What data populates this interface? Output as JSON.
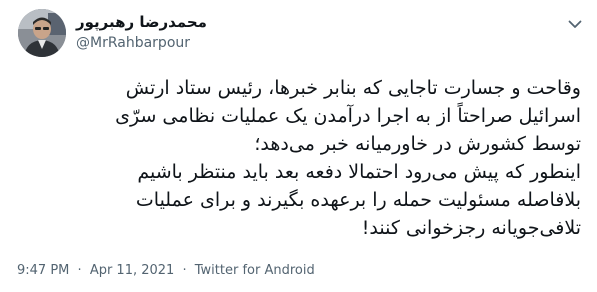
{
  "author": {
    "display_name": "محمدرضا رهبرپور",
    "handle": "@MrRahbarpour",
    "avatar_icon": "profile-photo"
  },
  "menu": {
    "icon": "chevron-down-icon"
  },
  "tweet": {
    "lines": [
      "وقاحت و جسارت تاجایی که بنابر خبرها، رئیس ستاد ارتش",
      "اسرائیل صراحتاً از به اجرا درآمدن یک عملیات نظامی سرّی",
      "توسط کشورش در خاورمیانه خبر می‌دهد؛",
      "اینطور که پیش می‌رود احتمالا دفعه بعد باید منتظر باشیم",
      "بلافاصله مسئولیت حمله را برعهده بگیرند و برای عملیات",
      "تلافی‌جویانه رجزخوانی کنند!"
    ]
  },
  "meta": {
    "time": "9:47 PM",
    "separator": "·",
    "date": "Apr 11, 2021",
    "source": "Twitter for Android"
  },
  "colors": {
    "text": "#0f1419",
    "secondary": "#536471",
    "background": "#ffffff"
  }
}
